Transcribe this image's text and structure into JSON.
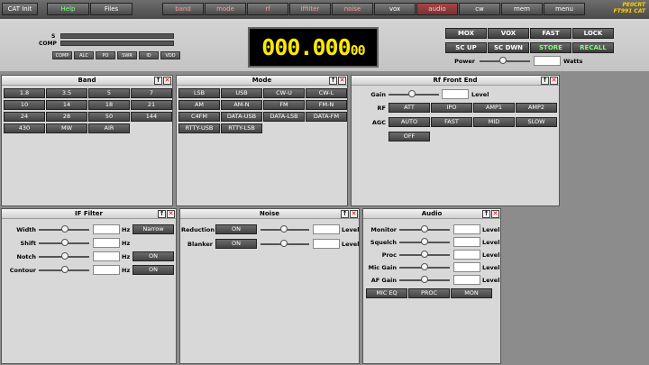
{
  "toolbar": {
    "buttons": [
      "CAT Init",
      "Help",
      "Files",
      "band",
      "mode",
      "rf",
      "iffilter",
      "noise",
      "vox",
      "audio",
      "cw",
      "mem",
      "menu"
    ],
    "logo_line1": "PE0CRT",
    "logo_line2": "FT991 CAT"
  },
  "meters": {
    "s_label": "S",
    "comp_label": "COMP",
    "buttons": [
      "COMP",
      "ALC",
      "PO",
      "SWR",
      "ID",
      "VDD"
    ]
  },
  "frequency": {
    "main": "000.000",
    "small": "00"
  },
  "side_buttons": [
    "MOX",
    "VOX",
    "FAST",
    "LOCK",
    "SC UP",
    "SC DWN",
    "STORE",
    "RECALL"
  ],
  "power": {
    "label": "Power",
    "unit": "Watts",
    "value": ""
  },
  "band": {
    "title": "Band",
    "buttons": [
      "1.8",
      "3.5",
      "5",
      "7",
      "10",
      "14",
      "18",
      "21",
      "24",
      "28",
      "50",
      "144",
      "430",
      "MW",
      "AIR"
    ]
  },
  "mode": {
    "title": "Mode",
    "buttons": [
      "LSB",
      "USB",
      "CW-U",
      "CW-L",
      "AM",
      "AM-N",
      "FM",
      "FM-N",
      "C4FM",
      "DATA-USB",
      "DATA-LSB",
      "DATA-FM",
      "RTTY-USB",
      "RTTY-LSB"
    ]
  },
  "rf": {
    "title": "Rf Front End",
    "gain_label": "Gain",
    "level_label": "Level",
    "rf_label": "RF",
    "rf_buttons": [
      "ATT",
      "IPO",
      "AMP1",
      "AMP2"
    ],
    "agc_label": "AGC",
    "agc_buttons": [
      "AUTO",
      "FAST",
      "MID",
      "SLOW",
      "OFF"
    ]
  },
  "iffilter": {
    "title": "IF Filter",
    "rows": [
      {
        "label": "Width",
        "unit": "Hz",
        "button": "Narrow"
      },
      {
        "label": "Shift",
        "unit": "Hz",
        "button": ""
      },
      {
        "label": "Notch",
        "unit": "Hz",
        "button": "ON"
      },
      {
        "label": "Contour",
        "unit": "Hz",
        "button": "ON"
      }
    ]
  },
  "noise": {
    "title": "Noise",
    "rows": [
      {
        "label": "Reduction",
        "button": "ON",
        "unit": "Level"
      },
      {
        "label": "Blanker",
        "button": "ON",
        "unit": "Level"
      }
    ]
  },
  "audio": {
    "title": "Audio",
    "rows": [
      "Monitor",
      "Squelch",
      "Proc",
      "Mic Gain",
      "AF Gain"
    ],
    "unit": "Level",
    "buttons": [
      "MIC EQ",
      "PROC",
      "MON"
    ]
  }
}
